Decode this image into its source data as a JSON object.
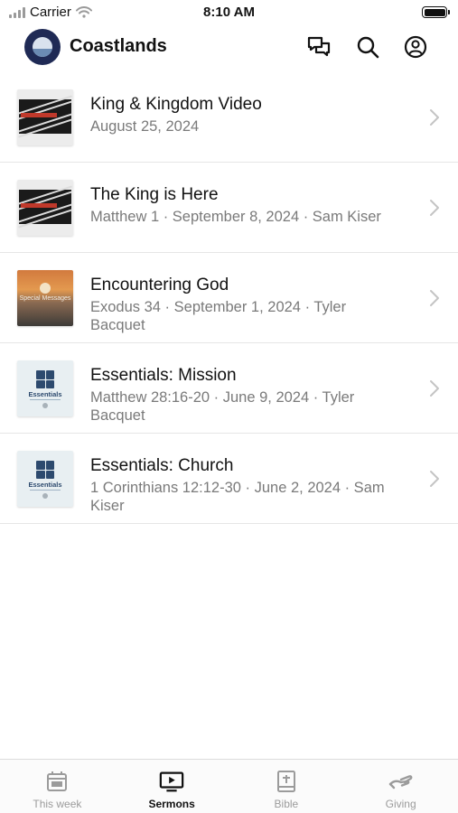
{
  "status_bar": {
    "carrier": "Carrier",
    "time": "8:10 AM"
  },
  "header": {
    "title": "Coastlands"
  },
  "sermons": [
    {
      "title": "King & Kingdom Video",
      "meta": "August 25, 2024",
      "thumbnail": "king-and-kingdom"
    },
    {
      "title": "The King is Here",
      "meta": "Matthew 1 · September 8, 2024 · Sam Kiser",
      "thumbnail": "king-and-kingdom"
    },
    {
      "title": "Encountering God",
      "meta": "Exodus 34 · September 1, 2024 · Tyler Bacquet",
      "thumbnail": "special-messages",
      "thumbnail_text": "Special Messages"
    },
    {
      "title": "Essentials: Mission",
      "meta": "Matthew 28:16-20 · June 9, 2024 · Tyler Bacquet",
      "thumbnail": "essentials",
      "thumbnail_text": "Essentials"
    },
    {
      "title": "Essentials: Church",
      "meta": "1 Corinthians 12:12-30 · June 2, 2024 · Sam Kiser",
      "thumbnail": "essentials",
      "thumbnail_text": "Essentials"
    }
  ],
  "tabs": [
    {
      "label": "This week",
      "icon": "calendar-icon",
      "active": false
    },
    {
      "label": "Sermons",
      "icon": "video-play-icon",
      "active": true
    },
    {
      "label": "Bible",
      "icon": "bible-icon",
      "active": false
    },
    {
      "label": "Giving",
      "icon": "giving-hand-icon",
      "active": false
    }
  ],
  "colors": {
    "logo_bg": "#1f2a55",
    "active_tab": "#111111",
    "inactive_tab": "#9b9b9b",
    "meta_text": "#7a7a7a"
  }
}
